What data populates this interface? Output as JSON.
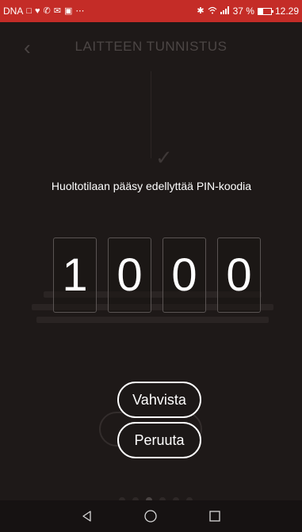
{
  "status_bar": {
    "carrier": "DNA",
    "battery_percent": "37 %",
    "time": "12.29",
    "accent_color": "#c42c27",
    "icons": [
      "sim-icon",
      "heart-icon",
      "whatsapp-icon",
      "mail-icon",
      "image-icon",
      "more-icon",
      "bluetooth-icon",
      "wifi-icon",
      "signal-icon",
      "battery-icon"
    ]
  },
  "background": {
    "title": "LAITTEEN TUNNISTUS"
  },
  "dialog": {
    "prompt": "Huoltotilaan pääsy edellyttää PIN-koodia",
    "pin_digits": [
      "1",
      "0",
      "0",
      "0"
    ],
    "confirm_label": "Vahvista",
    "cancel_label": "Peruuta"
  },
  "nav": {
    "icons": [
      "back-icon",
      "home-icon",
      "recents-icon"
    ]
  }
}
